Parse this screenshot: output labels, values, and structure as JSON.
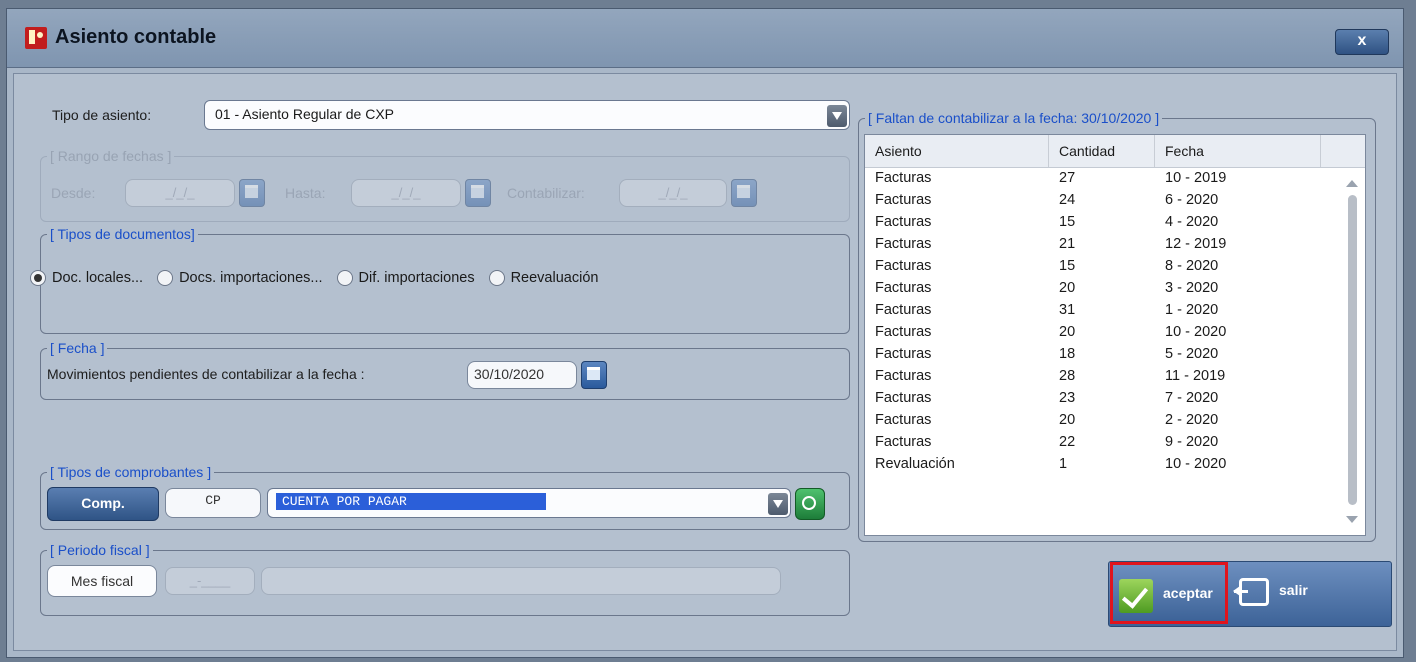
{
  "window": {
    "title": "Asiento contable",
    "close_label": "x"
  },
  "tipo_asiento": {
    "label": "Tipo de asiento:",
    "value": "01 - Asiento Regular de CXP"
  },
  "rango_fechas": {
    "title": "[ Rango de fechas ]",
    "desde_label": "Desde:",
    "desde_value": "_/_/_",
    "hasta_label": "Hasta:",
    "hasta_value": "_/_/_",
    "contabilizar_label": "Contabilizar:",
    "contabilizar_value": "_/_/_"
  },
  "tipos_documentos": {
    "title": "[ Tipos de documentos]",
    "options": [
      {
        "label": "Doc. locales...",
        "selected": true
      },
      {
        "label": "Docs. importaciones...",
        "selected": false
      },
      {
        "label": "Dif. importaciones",
        "selected": false
      },
      {
        "label": "Reevaluación",
        "selected": false
      }
    ]
  },
  "fecha": {
    "title": "[ Fecha ]",
    "label": "Movimientos pendientes de contabilizar a la fecha :",
    "value": "30/10/2020"
  },
  "tipos_comprobantes": {
    "title": "[ Tipos de comprobantes ]",
    "comp_button": "Comp.",
    "code": "CP",
    "description": "CUENTA POR PAGAR"
  },
  "periodo_fiscal": {
    "title": "[ Periodo fiscal ]",
    "button": "Mes fiscal",
    "value": "_-____",
    "description": ""
  },
  "pendientes": {
    "title": "[ Faltan de contabilizar a la fecha: 30/10/2020 ]",
    "columns": [
      "Asiento",
      "Cantidad",
      "Fecha"
    ],
    "rows": [
      [
        "Facturas",
        "27",
        "10 - 2019"
      ],
      [
        "Facturas",
        "24",
        "6 - 2020"
      ],
      [
        "Facturas",
        "15",
        "4 - 2020"
      ],
      [
        "Facturas",
        "21",
        "12 - 2019"
      ],
      [
        "Facturas",
        "15",
        "8 - 2020"
      ],
      [
        "Facturas",
        "20",
        "3 - 2020"
      ],
      [
        "Facturas",
        "31",
        "1 - 2020"
      ],
      [
        "Facturas",
        "20",
        "10 - 2020"
      ],
      [
        "Facturas",
        "18",
        "5 - 2020"
      ],
      [
        "Facturas",
        "28",
        "11 - 2019"
      ],
      [
        "Facturas",
        "23",
        "7 - 2020"
      ],
      [
        "Facturas",
        "20",
        "2 - 2020"
      ],
      [
        "Facturas",
        "22",
        "9 - 2020"
      ],
      [
        "Revaluación",
        "1",
        "10 - 2020"
      ]
    ]
  },
  "actions": {
    "accept_label": "aceptar",
    "exit_label": "salir"
  },
  "colors": {
    "group_title": "#1a4fc9",
    "selection": "#2b5fd9",
    "highlight_border": "#e0141d"
  }
}
